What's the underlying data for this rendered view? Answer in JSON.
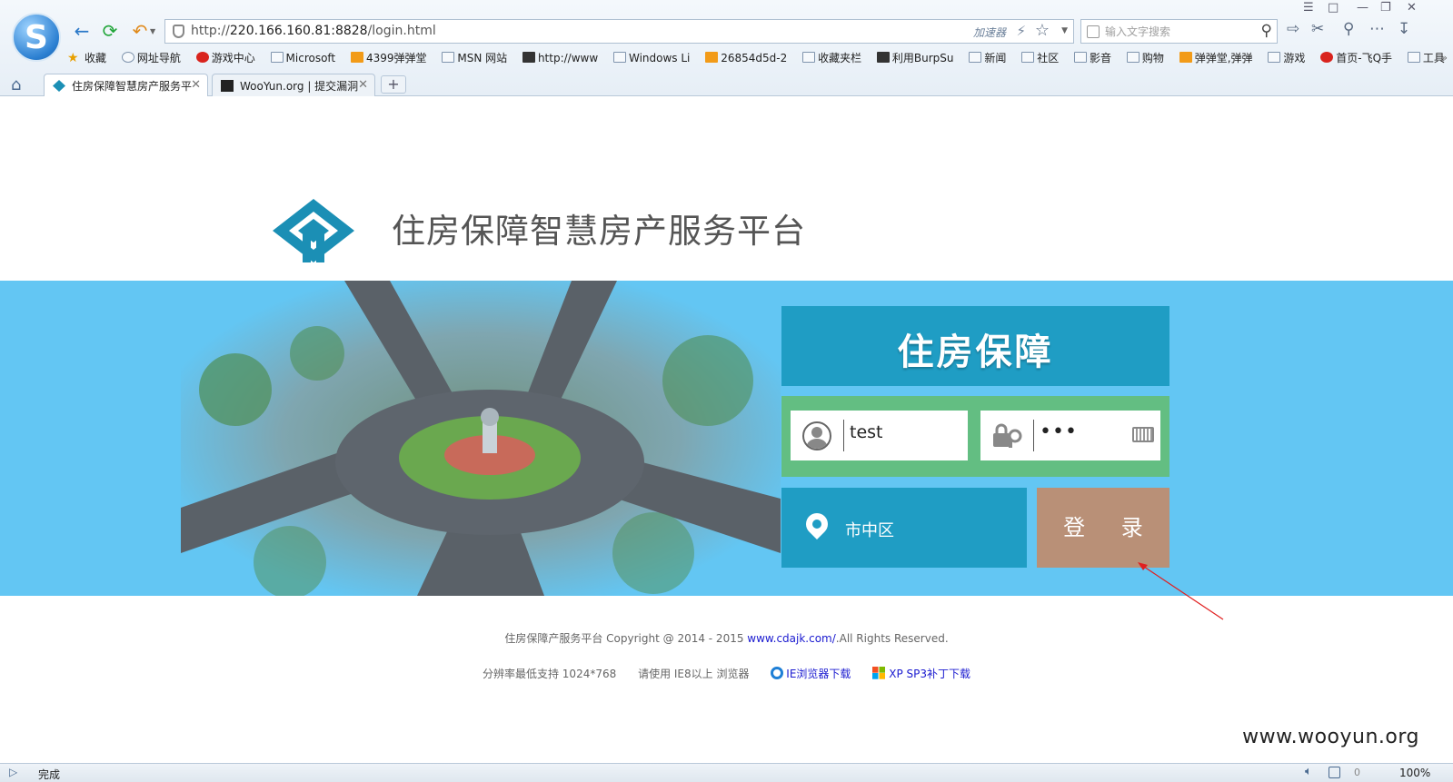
{
  "browser": {
    "logo_letter": "S",
    "url_prefix": "http://",
    "url_host": "220.166.160.81:8828",
    "url_path": "/login.html",
    "accelerator_label": "加速器",
    "search_placeholder": "输入文字搜索",
    "bookmarks": [
      {
        "label": "收藏",
        "icon": "star-icon"
      },
      {
        "label": "网址导航",
        "icon": "globe-icon"
      },
      {
        "label": "游戏中心",
        "icon": "game-icon"
      },
      {
        "label": "Microsoft",
        "icon": "folder-icon"
      },
      {
        "label": "4399弹弹堂",
        "icon": "game-icon"
      },
      {
        "label": "MSN 网站",
        "icon": "folder-icon"
      },
      {
        "label": "http://www",
        "icon": "page-icon"
      },
      {
        "label": "Windows Li",
        "icon": "folder-icon"
      },
      {
        "label": "26854d5d-2",
        "icon": "page-icon"
      },
      {
        "label": "收藏夹栏",
        "icon": "folder-icon"
      },
      {
        "label": "利用BurpSu",
        "icon": "page-icon"
      },
      {
        "label": "新闻",
        "icon": "folder-icon"
      },
      {
        "label": "社区",
        "icon": "folder-icon"
      },
      {
        "label": "影音",
        "icon": "folder-icon"
      },
      {
        "label": "购物",
        "icon": "folder-icon"
      },
      {
        "label": "弹弹堂,弹弹",
        "icon": "page-icon"
      },
      {
        "label": "游戏",
        "icon": "folder-icon"
      },
      {
        "label": "首页-飞Q手",
        "icon": "page-icon"
      },
      {
        "label": "工具",
        "icon": "folder-icon"
      }
    ],
    "tabs": [
      {
        "title": "住房保障智慧房产服务平",
        "active": true
      },
      {
        "title": "WooYun.org | 提交漏洞",
        "active": false
      }
    ],
    "new_tab_label": "+",
    "status_text": "完成",
    "status_count": "0",
    "zoom_level": "100%"
  },
  "page": {
    "site_title": "住房保障智慧房产服务平台",
    "login_heading": "住房保障",
    "username_value": "test",
    "password_value": "•••",
    "region_value": "市中区",
    "login_button_label": "登 录",
    "copyright_prefix": "住房保障产服务平台 Copyright @ 2014 - 2015 ",
    "copyright_link": "www.cdajk.com/",
    "copyright_suffix": ".All Rights Reserved.",
    "resolution_note": "分辨率最低支持 1024*768",
    "browser_note": "请使用 IE8以上 浏览器",
    "ie_download_label": "IE浏览器下载",
    "xp_patch_label": "XP SP3补丁下载"
  },
  "watermark": "www.wooyun.org",
  "colors": {
    "banner": "#63c6f3",
    "login_header": "#1f9dc4",
    "credentials_bg": "#63be82",
    "login_button": "#b99077"
  }
}
